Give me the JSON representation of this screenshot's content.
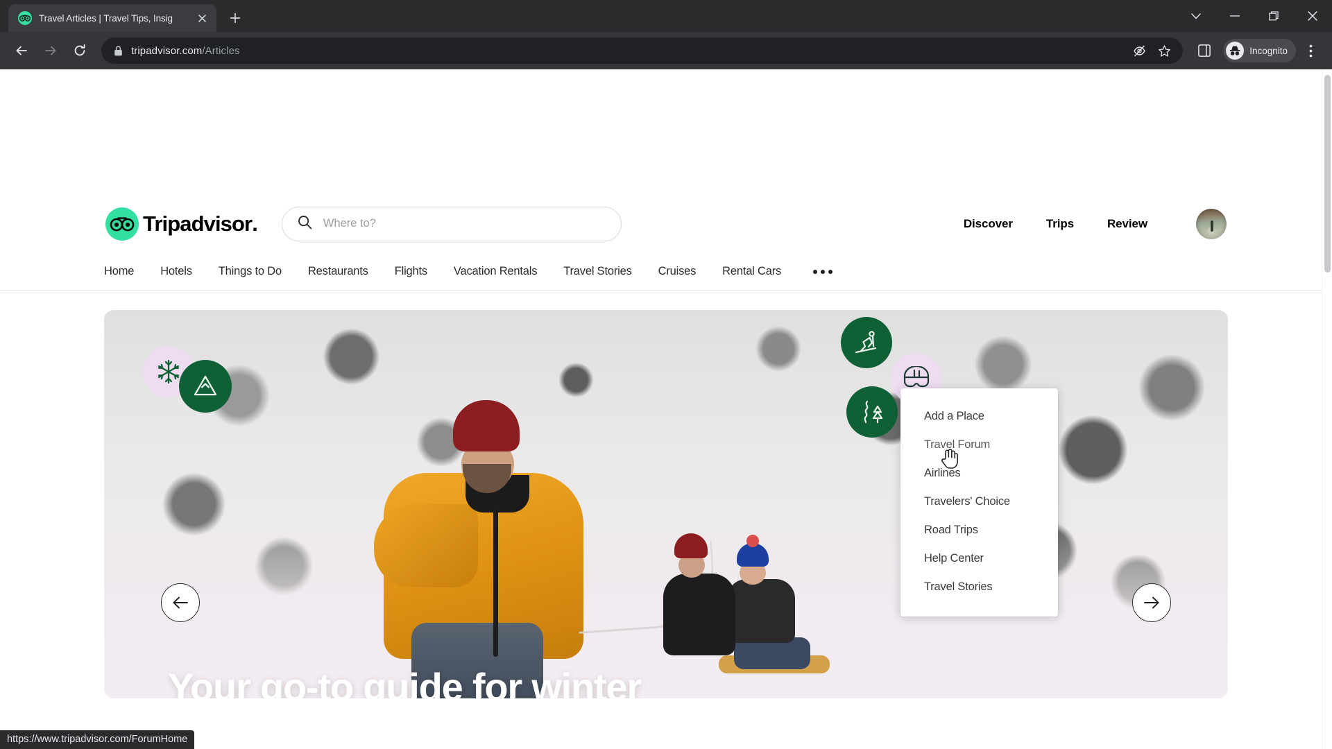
{
  "browser": {
    "tab": {
      "title": "Travel Articles | Travel Tips, Insig",
      "favicon": "tripadvisor-owl-icon",
      "close_icon": "close-icon"
    },
    "new_tab_icon": "plus-icon",
    "window_controls": {
      "tab_search_icon": "chevron-down-icon",
      "minimize_icon": "minimize-icon",
      "restore_icon": "restore-icon",
      "close_icon": "close-icon"
    },
    "toolbar": {
      "back_icon": "back-arrow-icon",
      "forward_icon": "forward-arrow-icon",
      "reload_icon": "reload-icon",
      "lock_icon": "lock-icon",
      "url_domain": "tripadvisor.com",
      "url_path": "/Articles",
      "tracking_protection_icon": "eye-slash-icon",
      "bookmark_icon": "star-icon",
      "side_panel_icon": "side-panel-icon",
      "profile_icon": "incognito-icon",
      "profile_label": "Incognito",
      "menu_icon": "three-dots-vertical-icon"
    },
    "status_bar_url": "https://www.tripadvisor.com/ForumHome"
  },
  "site": {
    "logo": {
      "icon": "tripadvisor-owl-icon",
      "wordmark": "Tripadvisor",
      "trademark_dot": "."
    },
    "search": {
      "icon": "search-icon",
      "placeholder": "Where to?",
      "value": ""
    },
    "header_nav": [
      {
        "label": "Discover"
      },
      {
        "label": "Trips"
      },
      {
        "label": "Review"
      }
    ],
    "avatar": "user-avatar",
    "category_nav": [
      {
        "label": "Home"
      },
      {
        "label": "Hotels"
      },
      {
        "label": "Things to Do"
      },
      {
        "label": "Restaurants"
      },
      {
        "label": "Flights"
      },
      {
        "label": "Vacation Rentals"
      },
      {
        "label": "Travel Stories"
      },
      {
        "label": "Cruises"
      },
      {
        "label": "Rental Cars"
      }
    ],
    "more_button": {
      "icon": "three-dots-horizontal-icon",
      "label": ""
    },
    "dropdown": {
      "open": true,
      "items": [
        {
          "label": "Add a Place",
          "hovered": false
        },
        {
          "label": "Travel Forum",
          "hovered": true
        },
        {
          "label": "Airlines",
          "hovered": false
        },
        {
          "label": "Travelers' Choice",
          "hovered": false
        },
        {
          "label": "Road Trips",
          "hovered": false
        },
        {
          "label": "Help Center",
          "hovered": false
        },
        {
          "label": "Travel Stories",
          "hovered": false
        }
      ]
    },
    "hero": {
      "title": "Your go-to guide for winter",
      "alt": "Family sledding in a snowy forest",
      "prev_icon": "arrow-left-icon",
      "next_icon": "arrow-right-icon",
      "badges": [
        {
          "name": "snowflake-icon",
          "style": "lavender"
        },
        {
          "name": "mountain-icon",
          "style": "green"
        },
        {
          "name": "skier-icon",
          "style": "green"
        },
        {
          "name": "ski-goggles-icon",
          "style": "lavender"
        },
        {
          "name": "snowy-trail-icon",
          "style": "green"
        }
      ]
    }
  },
  "colors": {
    "brand_green": "#34e0a1",
    "badge_green": "#0f6135",
    "badge_lavender": "#eedcf0",
    "chrome_dark": "#35363a",
    "omnibox_dark": "#202124",
    "parka_yellow": "#e09314"
  }
}
